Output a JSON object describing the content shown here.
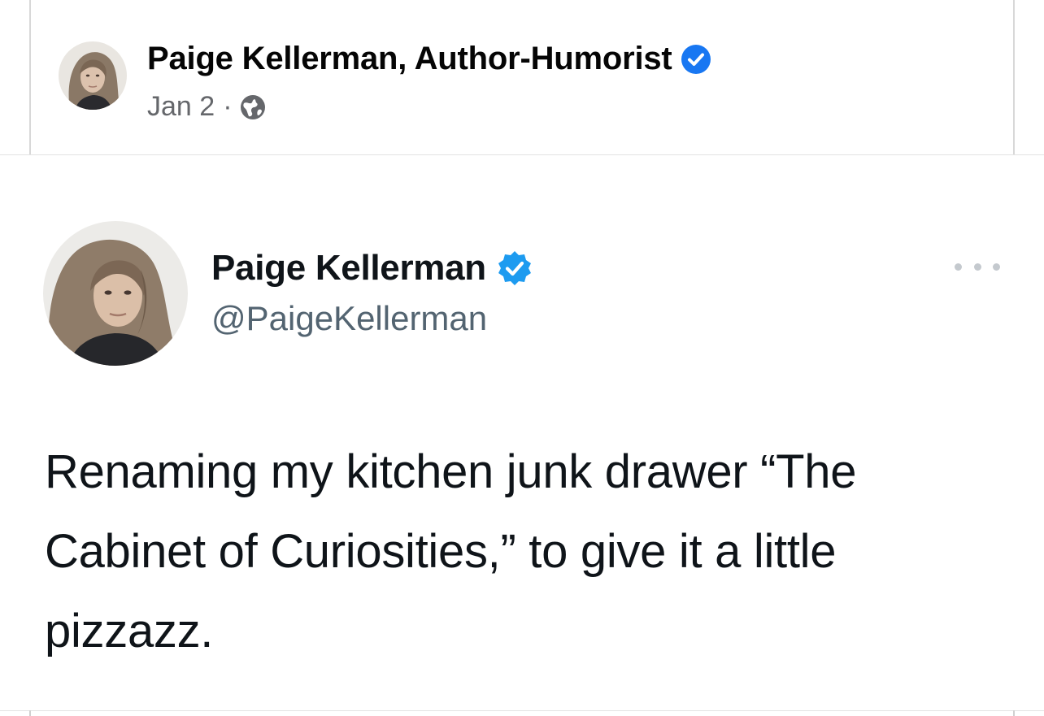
{
  "facebook_post": {
    "author_name": "Paige Kellerman, Author-Humorist",
    "date": "Jan 2",
    "separator": "·",
    "audience_icon": "globe-icon",
    "verified_icon": "verified-badge-icon",
    "verified_color": "#1877f2"
  },
  "tweet": {
    "display_name": "Paige Kellerman",
    "handle": "@PaigeKellerman",
    "verified_icon": "verified-badge-icon",
    "verified_color": "#1d9bf0",
    "more_icon": "more-options-icon",
    "text": "Renaming my kitchen junk drawer “The Cabinet of Curiosities,” to give it a little pizzazz."
  }
}
